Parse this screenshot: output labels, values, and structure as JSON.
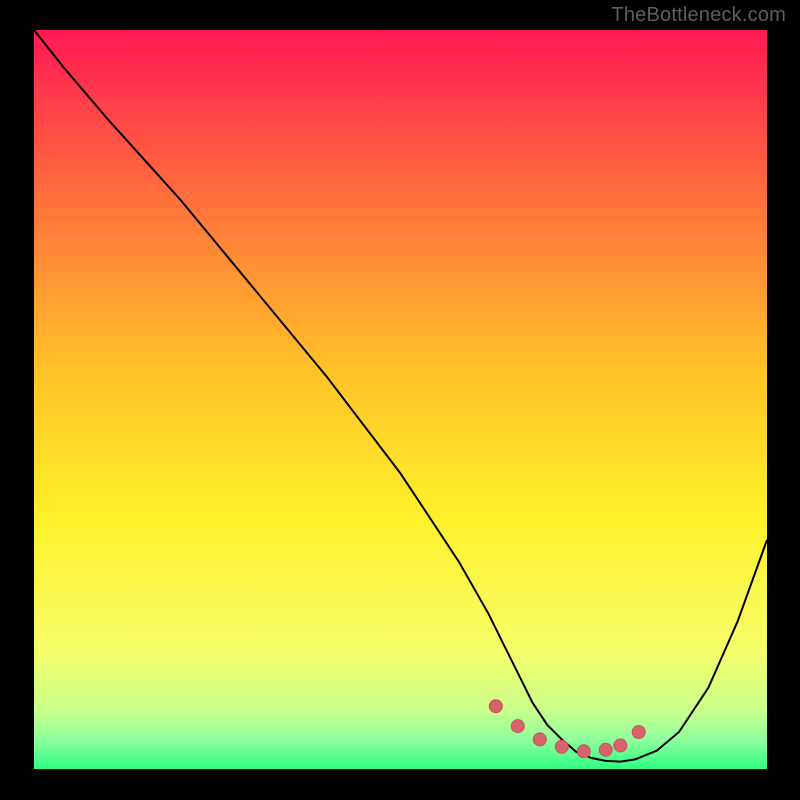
{
  "watermark": "TheBottleneck.com",
  "colors": {
    "black": "#000000",
    "curve": "#000000",
    "marker_fill": "#d6636b",
    "marker_stroke": "#cc515a",
    "grad_top": "#ff1953",
    "grad_upper": "#ff6d3d",
    "grad_mid_hi": "#ffc228",
    "grad_mid": "#fff02b",
    "grad_lo": "#f6ff6a",
    "grad_lower1": "#caff8a",
    "grad_lower2": "#8fff9d",
    "grad_bottom": "#2fff82"
  },
  "chart_data": {
    "type": "line",
    "title": "",
    "xlabel": "",
    "ylabel": "",
    "xlim": [
      0,
      100
    ],
    "ylim": [
      0,
      100
    ],
    "grid": false,
    "legend": false,
    "annotations": [],
    "series": [
      {
        "name": "curve",
        "x": [
          0,
          4,
          10,
          20,
          30,
          40,
          50,
          58,
          62,
          64,
          66,
          68,
          70,
          72,
          74,
          76,
          78,
          80,
          82,
          85,
          88,
          92,
          96,
          100
        ],
        "y": [
          100,
          95,
          88,
          77,
          65,
          53,
          40,
          28,
          21,
          17,
          13,
          9,
          6,
          4,
          2.3,
          1.5,
          1.1,
          1.0,
          1.3,
          2.5,
          5,
          11,
          20,
          31
        ]
      }
    ],
    "markers": {
      "name": "bottom-highlight",
      "x": [
        63,
        66,
        69,
        72,
        75,
        78,
        80,
        82.5
      ],
      "y": [
        8.5,
        5.8,
        4.0,
        3.0,
        2.4,
        2.6,
        3.2,
        5.0
      ]
    }
  }
}
